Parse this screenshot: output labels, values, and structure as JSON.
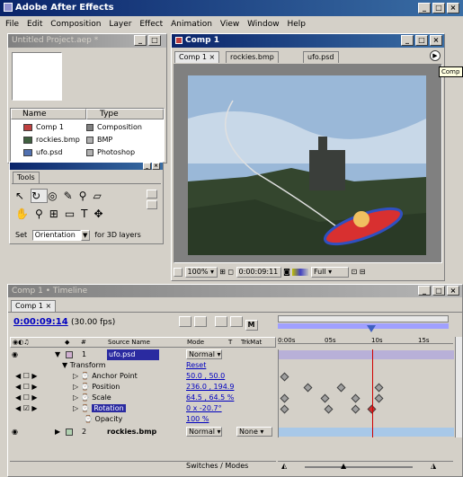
{
  "app": {
    "title": "Adobe After Effects"
  },
  "menu": [
    "File",
    "Edit",
    "Composition",
    "Layer",
    "Effect",
    "Animation",
    "View",
    "Window",
    "Help"
  ],
  "project": {
    "title": "Untitled Project.aep *",
    "col_name": "Name",
    "col_type": "Type",
    "items": [
      {
        "name": "Comp 1",
        "type": "Composition"
      },
      {
        "name": "rockies.bmp",
        "type": "BMP"
      },
      {
        "name": "ufo.psd",
        "type": "Photoshop"
      }
    ]
  },
  "tools": {
    "title": "Tools",
    "set_label": "Set",
    "set_value": "Orientation",
    "for_label": "for 3D layers"
  },
  "comp": {
    "title": "Comp 1",
    "tabs": [
      "Comp 1",
      "rockies.bmp",
      "ufo.psd"
    ],
    "tooltip": "Comp",
    "zoom": "100%",
    "time": "0:00:09:11",
    "res": "Full"
  },
  "timeline": {
    "title": "Comp 1 • Timeline",
    "tab": "Comp 1",
    "timecode": "0:00:09:14",
    "fps": "(30.00 fps)",
    "ruler": [
      "0:00s",
      "05s",
      "10s",
      "15s"
    ],
    "headers": {
      "source": "Source Name",
      "mode": "Mode",
      "t": "T",
      "trkmat": "TrkMat"
    },
    "layers": [
      {
        "num": "1",
        "name": "ufo.psd",
        "mode": "Normal"
      },
      {
        "num": "2",
        "name": "rockies.bmp",
        "mode": "Normal",
        "trkmat": "None"
      }
    ],
    "transform": "Transform",
    "reset": "Reset",
    "props": [
      {
        "name": "Anchor Point",
        "value": "50.0 , 50.0"
      },
      {
        "name": "Position",
        "value": "236.0 , 194.9"
      },
      {
        "name": "Scale",
        "value": "64.5 , 64.5 %"
      },
      {
        "name": "Rotation",
        "value": "0 x -20.7°"
      },
      {
        "name": "Opacity",
        "value": "100 %"
      }
    ],
    "footer": "Switches / Modes"
  },
  "colors": {
    "titlebar": "#0a246a",
    "selected": "#2a2aa0",
    "playhead": "#d00000"
  }
}
